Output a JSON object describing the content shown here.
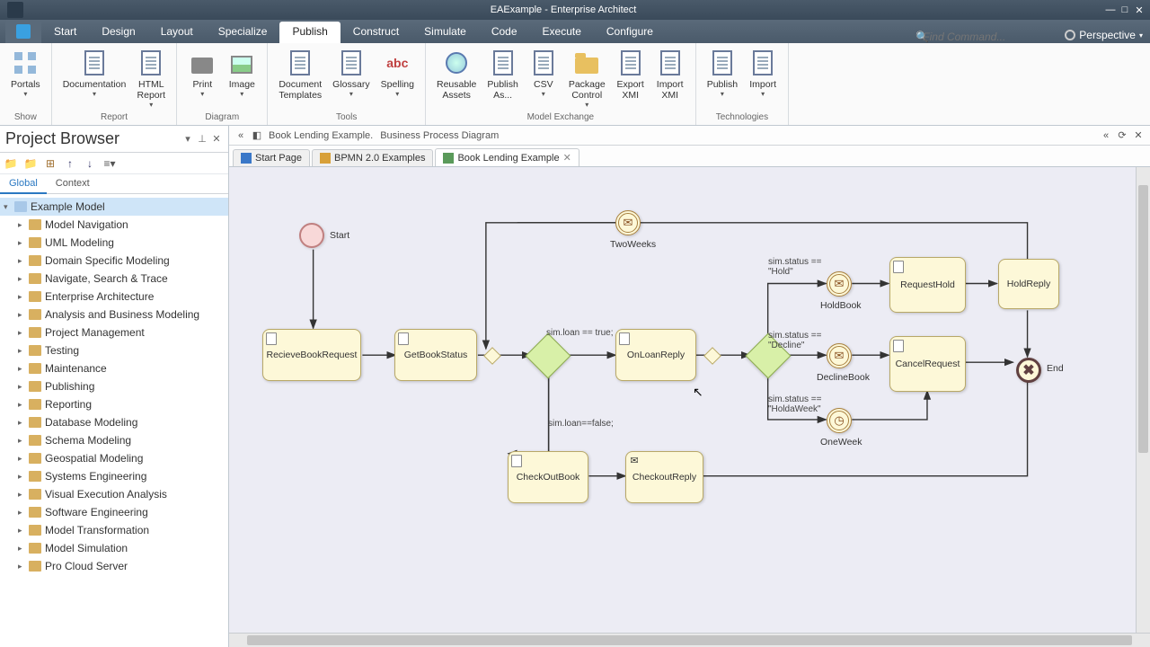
{
  "window": {
    "title": "EAExample - Enterprise Architect"
  },
  "menu": {
    "tabs": [
      {
        "label": "Start",
        "key": "S"
      },
      {
        "label": "Design",
        "key": "D"
      },
      {
        "label": "Layout",
        "key": "L"
      },
      {
        "label": "Specialize",
        "key": "E"
      },
      {
        "label": "Publish",
        "key": "P",
        "active": true
      },
      {
        "label": "Construct",
        "key": "N"
      },
      {
        "label": "Simulate",
        "key": "M"
      },
      {
        "label": "Code",
        "key": "O"
      },
      {
        "label": "Execute",
        "key": "X"
      },
      {
        "label": "Configure",
        "key": "C"
      }
    ],
    "find_placeholder": "Find Command...",
    "perspective": "Perspective",
    "perspective_key": "V"
  },
  "ribbon": {
    "groups": [
      {
        "name": "Show",
        "buttons": [
          {
            "label": "Portals",
            "drop": true,
            "ico": "4sq"
          }
        ]
      },
      {
        "name": "Report",
        "buttons": [
          {
            "label": "Documentation",
            "drop": true,
            "ico": "doc"
          },
          {
            "label": "HTML Report",
            "drop": true,
            "ico": "doc"
          }
        ]
      },
      {
        "name": "Diagram",
        "buttons": [
          {
            "label": "Print",
            "drop": true,
            "ico": "print"
          },
          {
            "label": "Image",
            "drop": true,
            "ico": "img"
          }
        ]
      },
      {
        "name": "Tools",
        "buttons": [
          {
            "label": "Document Templates",
            "ico": "doc"
          },
          {
            "label": "Glossary",
            "drop": true,
            "ico": "doc"
          },
          {
            "label": "Spelling",
            "drop": true,
            "ico": "abc"
          }
        ]
      },
      {
        "name": "Model Exchange",
        "buttons": [
          {
            "label": "Reusable Assets",
            "ico": "globe"
          },
          {
            "label": "Publish As...",
            "ico": "doc"
          },
          {
            "label": "CSV",
            "drop": true,
            "ico": "doc"
          },
          {
            "label": "Package Control",
            "drop": true,
            "ico": "folder"
          },
          {
            "label": "Export XMI",
            "ico": "doc"
          },
          {
            "label": "Import XMI",
            "ico": "doc"
          }
        ]
      },
      {
        "name": "Technologies",
        "buttons": [
          {
            "label": "Publish",
            "drop": true,
            "ico": "doc"
          },
          {
            "label": "Import",
            "drop": true,
            "ico": "doc"
          }
        ]
      }
    ]
  },
  "browser": {
    "title": "Project Browser",
    "tabs": [
      {
        "label": "Global",
        "active": true
      },
      {
        "label": "Context"
      }
    ],
    "root": "Example Model",
    "items": [
      "Model Navigation",
      "UML Modeling",
      "Domain Specific Modeling",
      "Navigate, Search & Trace",
      "Enterprise Architecture",
      "Analysis and Business Modeling",
      "Project Management",
      "Testing",
      "Maintenance",
      "Publishing",
      "Reporting",
      "Database Modeling",
      "Schema Modeling",
      "Geospatial Modeling",
      "Systems Engineering",
      "Visual Execution Analysis",
      "Software Engineering",
      "Model Transformation",
      "Model Simulation",
      "Pro Cloud Server"
    ]
  },
  "canvas": {
    "breadcrumb": [
      "Book Lending Example.",
      "Business Process Diagram"
    ],
    "tabs": [
      {
        "label": "Start Page",
        "ico": "start"
      },
      {
        "label": "BPMN 2.0 Examples",
        "ico": "pkg"
      },
      {
        "label": "Book Lending Example",
        "ico": "diag",
        "active": true,
        "closable": true
      }
    ],
    "nodes": {
      "start": "Start",
      "recv": "RecieveBookRequest",
      "getstatus": "GetBookStatus",
      "onloan": "OnLoanReply",
      "checkout": "CheckOutBook",
      "coreply": "CheckoutReply",
      "holdbook": "HoldBook",
      "reqhold": "RequestHold",
      "holdreply": "HoldReply",
      "decline": "DeclineBook",
      "cancel": "CancelRequest",
      "oneweek": "OneWeek",
      "twoweeks": "TwoWeeks",
      "end": "End"
    },
    "edge_labels": {
      "loan_true": "sim.loan == true;",
      "loan_false": "sim.loan==false;",
      "status_hold": "sim.status ==\n\"Hold\"",
      "status_decline": "sim.status ==\n\"Decline\"",
      "status_holdweek": "sim.status ==\n\"HoldaWeek\""
    }
  }
}
